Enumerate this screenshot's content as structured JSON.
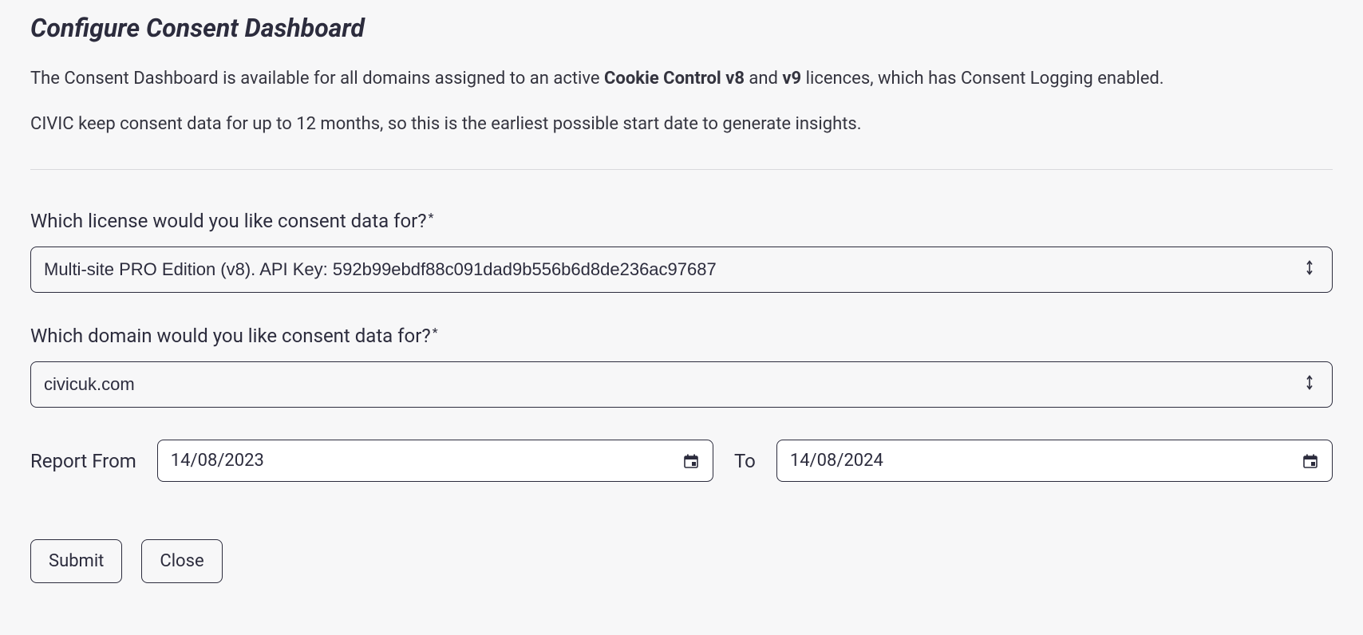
{
  "header": {
    "title": "Configure Consent Dashboard"
  },
  "intro": {
    "p1_prefix": "The Consent Dashboard is available for all domains assigned to an active ",
    "p1_bold1": "Cookie Control v8",
    "p1_mid": " and ",
    "p1_bold2": "v9",
    "p1_suffix": " licences, which has Consent Logging enabled.",
    "p2": "CIVIC keep consent data for up to 12 months, so this is the earliest possible start date to generate insights."
  },
  "form": {
    "license": {
      "label": "Which license would you like consent data for?",
      "required_marker": "*",
      "selected": "Multi-site PRO Edition (v8). API Key: 592b99ebdf88c091dad9b556b6d8de236ac97687"
    },
    "domain": {
      "label": "Which domain would you like consent data for?",
      "required_marker": "*",
      "selected": "civicuk.com"
    },
    "date_from": {
      "label": "Report From",
      "value": "14/08/2023"
    },
    "date_to": {
      "label": "To",
      "value": "14/08/2024"
    },
    "buttons": {
      "submit": "Submit",
      "close": "Close"
    }
  }
}
